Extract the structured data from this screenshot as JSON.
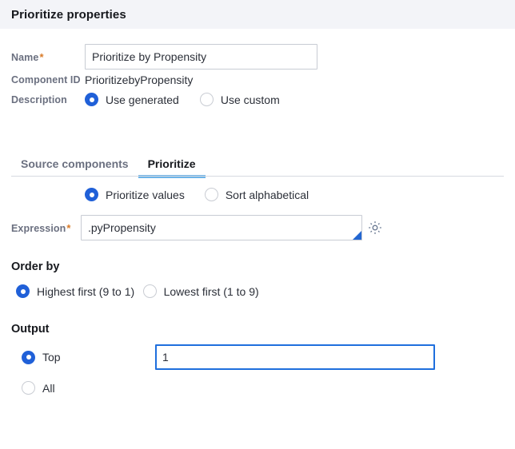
{
  "header": {
    "title": "Prioritize properties",
    "background": "#f3f4f8"
  },
  "colors": {
    "accent": "#2060d8",
    "tab_indicator": "#6cb3e8",
    "required_star": "#d97b29",
    "label_text": "#6b7080",
    "focus_border": "#1f6fdd"
  },
  "form": {
    "name": {
      "label": "Name",
      "required_marker": "*",
      "value": "Prioritize by Propensity",
      "placeholder": ""
    },
    "component_id": {
      "label": "Component ID",
      "value": "PrioritizebyPropensity"
    },
    "description": {
      "label": "Description",
      "options": [
        {
          "label": "Use generated",
          "selected": true
        },
        {
          "label": "Use custom",
          "selected": false
        }
      ]
    }
  },
  "tabs": [
    {
      "label": "Source components",
      "active": false
    },
    {
      "label": "Prioritize",
      "active": true
    }
  ],
  "prioritize_tab": {
    "mode_options": [
      {
        "label": "Prioritize values",
        "selected": true
      },
      {
        "label": "Sort alphabetical",
        "selected": false
      }
    ],
    "expression": {
      "label": "Expression",
      "required_marker": "*",
      "value": ".pyPropensity",
      "placeholder": "",
      "gear_icon": "gear-icon",
      "corner_marker": "expression-builder-triangle"
    },
    "order_by": {
      "heading": "Order by",
      "options": [
        {
          "label": "Highest first (9 to 1)",
          "selected": true
        },
        {
          "label": "Lowest first (1 to 9)",
          "selected": false
        }
      ]
    },
    "output": {
      "heading": "Output",
      "options": [
        {
          "label": "Top",
          "selected": true
        },
        {
          "label": "All",
          "selected": false
        }
      ],
      "top_count": {
        "value": "1",
        "placeholder": "",
        "focused": true
      }
    }
  }
}
